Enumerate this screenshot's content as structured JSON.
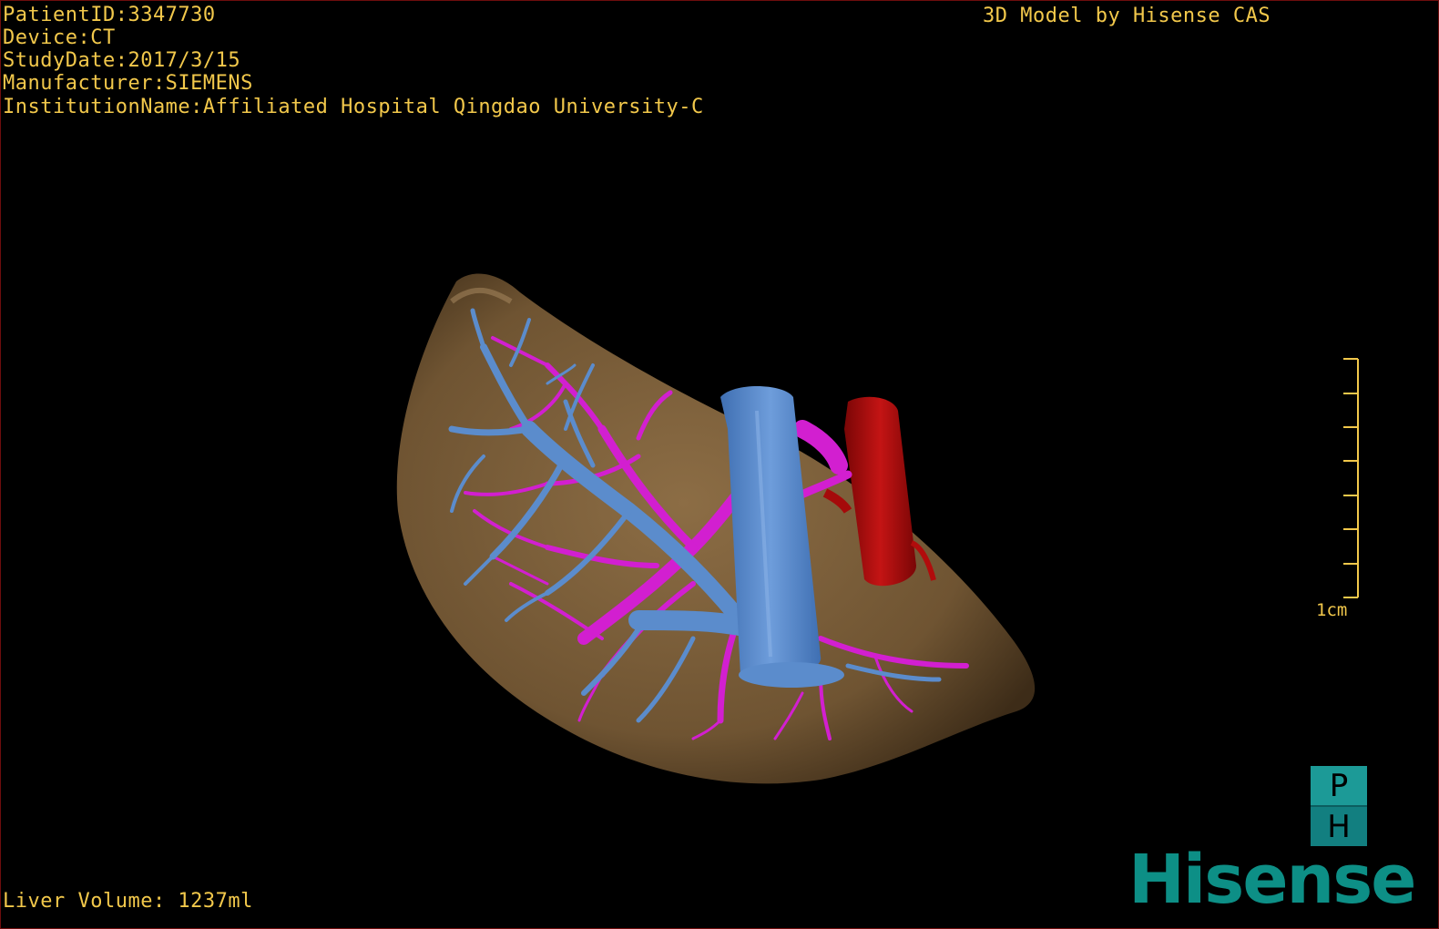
{
  "header": {
    "patient_id": "PatientID:3347730",
    "device": "Device:CT",
    "study_date": "StudyDate:2017/3/15",
    "manufacturer": "Manufacturer:SIEMENS",
    "institution": "InstitutionName:Affiliated Hospital Qingdao University-C",
    "credit": "3D Model by Hisense CAS"
  },
  "footer": {
    "liver_volume": "Liver Volume: 1237ml"
  },
  "scale_bar": {
    "label": "1cm"
  },
  "orientation_cube": {
    "top": "P",
    "bottom": "H"
  },
  "brand": {
    "name": "Hisense"
  },
  "colors": {
    "text": "#f2c84b",
    "liver": "#7a5e3b",
    "portal_vein": "#5b8ccc",
    "hepatic_vein": "#d21fd0",
    "artery": "#b00c0c",
    "brand": "#0d8f86"
  }
}
